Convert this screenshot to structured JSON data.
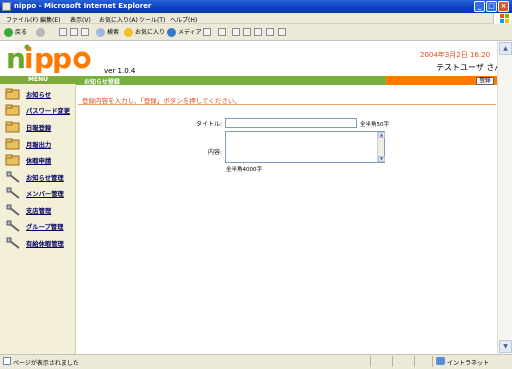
{
  "window": {
    "title": "nippo - Microsoft Internet Explorer",
    "minimize": "_",
    "maximize": "□",
    "close": "×"
  },
  "menubar": {
    "items": [
      "ファイル(F)",
      "編集(E)",
      "表示(V)",
      "お気に入り(A)",
      "ツール(T)",
      "ヘルプ(H)"
    ]
  },
  "toolbar": {
    "back": "戻る",
    "search": "検索",
    "favorites": "お気に入り",
    "media": "メディア"
  },
  "header": {
    "version": "ver 1.0.4",
    "datetime": "2004年3月2日 16:20",
    "user": "テストユーザ さん"
  },
  "sidebar": {
    "heading": "MENU",
    "items": [
      {
        "label": "お知らせ",
        "icon": "folder-icon"
      },
      {
        "label": "パスワード変更",
        "icon": "folder-icon"
      },
      {
        "label": "日報登録",
        "icon": "folder-icon"
      },
      {
        "label": "月報出力",
        "icon": "folder-icon"
      },
      {
        "label": "休暇申請",
        "icon": "folder-icon"
      },
      {
        "label": "お知らせ管理",
        "icon": "tools-icon"
      },
      {
        "label": "メンバー管理",
        "icon": "tools-icon"
      },
      {
        "label": "支店管理",
        "icon": "tools-icon"
      },
      {
        "label": "グループ管理",
        "icon": "tools-icon"
      },
      {
        "label": "有給休暇管理",
        "icon": "tools-icon"
      }
    ]
  },
  "content": {
    "title": "お知らせ登録",
    "register_label": "登録",
    "instruction": "登録内容を入力し、「登録」ボタンを押してください。",
    "form": {
      "title_label": "タイトル:",
      "title_value": "",
      "title_hint": "全半角50字",
      "body_label": "内容:",
      "body_value": "",
      "body_hint": "全半角4000字"
    }
  },
  "statusbar": {
    "text": "ページが表示されました",
    "zone": "イントラネット"
  },
  "colors": {
    "accent_orange": "#ff7a00",
    "menu_green": "#78b040",
    "instruction_red": "#e04b14",
    "nav_link": "#000060"
  }
}
